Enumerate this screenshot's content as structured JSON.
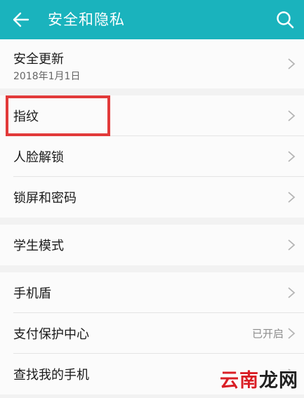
{
  "header": {
    "title": "安全和隐私",
    "bg_color": "#1ab3bd"
  },
  "group1": {
    "security_update": {
      "label": "安全更新",
      "date": "2018年1月1日"
    }
  },
  "group2": {
    "items": [
      {
        "label": "指纹"
      },
      {
        "label": "人脸解锁"
      },
      {
        "label": "锁屏和密码"
      }
    ]
  },
  "group3": {
    "items": [
      {
        "label": "学生模式"
      }
    ]
  },
  "group4": {
    "items": [
      {
        "label": "手机盾",
        "value": ""
      },
      {
        "label": "支付保护中心",
        "value": "已开启"
      },
      {
        "label": "查找我的手机",
        "value": ""
      }
    ]
  },
  "highlight_color": "#e23a3a",
  "watermark": {
    "part1": "云南",
    "part2": "龙网"
  },
  "icons": [
    "back-arrow-icon",
    "search-icon",
    "chevron-right-icon"
  ]
}
